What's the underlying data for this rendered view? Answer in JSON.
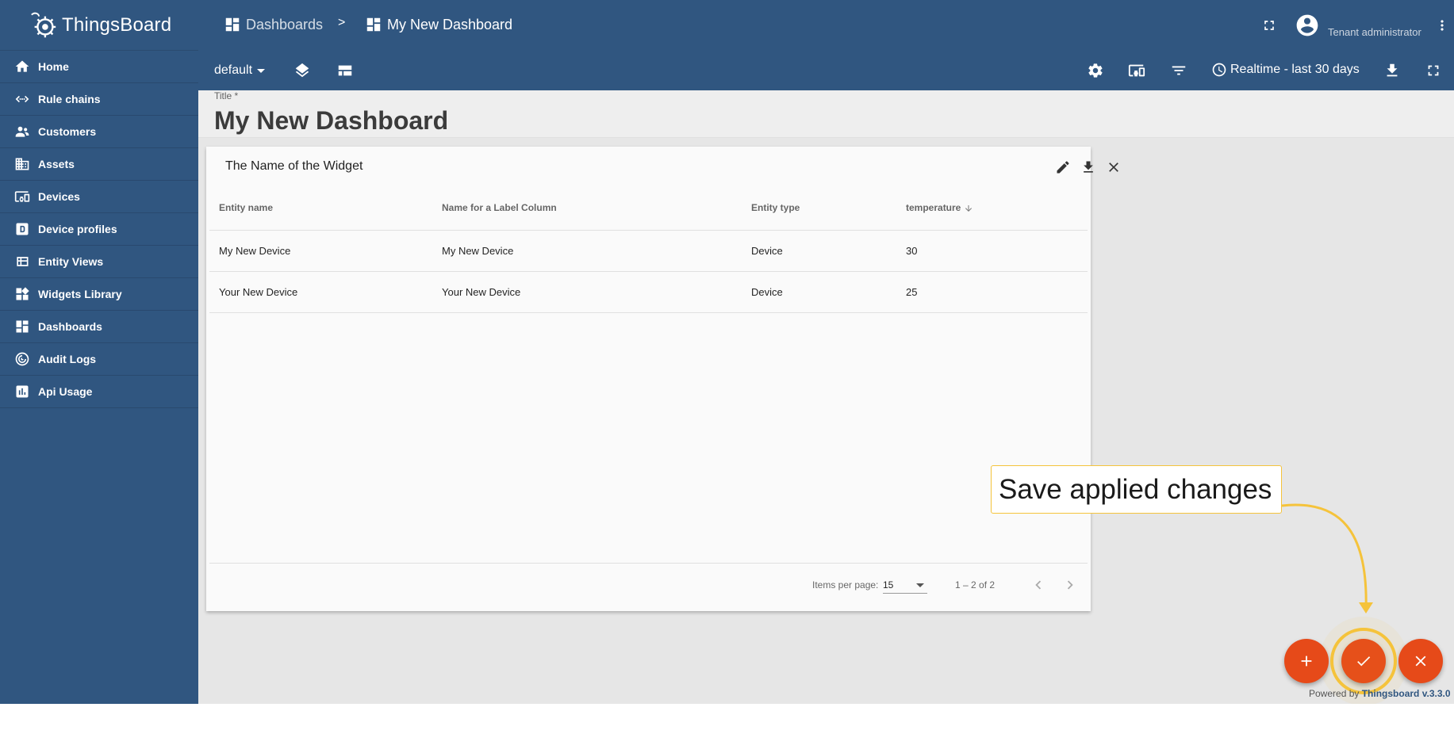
{
  "app": {
    "name": "ThingsBoard"
  },
  "sidebar": {
    "items": [
      {
        "label": "Home",
        "icon": "home-icon"
      },
      {
        "label": "Rule chains",
        "icon": "rule-chain-icon"
      },
      {
        "label": "Customers",
        "icon": "customers-icon"
      },
      {
        "label": "Assets",
        "icon": "assets-icon"
      },
      {
        "label": "Devices",
        "icon": "devices-icon"
      },
      {
        "label": "Device profiles",
        "icon": "device-profile-icon"
      },
      {
        "label": "Entity Views",
        "icon": "entity-views-icon"
      },
      {
        "label": "Widgets Library",
        "icon": "widgets-icon"
      },
      {
        "label": "Dashboards",
        "icon": "dashboards-icon"
      },
      {
        "label": "Audit Logs",
        "icon": "audit-logs-icon"
      },
      {
        "label": "Api Usage",
        "icon": "api-usage-icon"
      }
    ]
  },
  "header": {
    "breadcrumb": [
      {
        "label": "Dashboards"
      },
      {
        "label": "My New Dashboard"
      }
    ],
    "separator": ">",
    "user_role": "Tenant administrator"
  },
  "toolbar": {
    "state": "default",
    "timewindow": "Realtime - last 30 days"
  },
  "dashboard": {
    "title_label": "Title *",
    "title_value": "My New Dashboard"
  },
  "widget": {
    "title": "The Name of the Widget",
    "columns": [
      "Entity name",
      "Name for a Label Column",
      "Entity type",
      "temperature"
    ],
    "rows": [
      [
        "My New Device",
        "My New Device",
        "Device",
        "30"
      ],
      [
        "Your New Device",
        "Your New Device",
        "Device",
        "25"
      ]
    ],
    "paginator": {
      "items_per_page_label": "Items per page:",
      "items_per_page": "15",
      "range": "1 – 2 of 2"
    }
  },
  "callout": {
    "text": "Save applied changes"
  },
  "footer": {
    "powered_prefix": "Powered by",
    "powered_brand": "Thingsboard v.3.3.0"
  },
  "colors": {
    "primary": "#305680",
    "accent": "#e64a19",
    "highlight": "#f5c33b"
  }
}
